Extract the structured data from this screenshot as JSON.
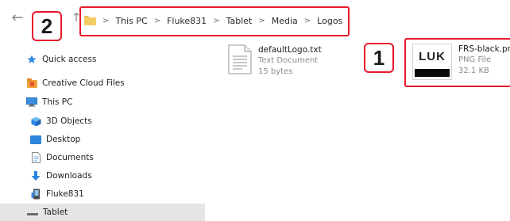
{
  "nav": {
    "back_icon": "←",
    "up_icon": "↑"
  },
  "breadcrumb": [
    "This PC",
    "Fluke831",
    "Tablet",
    "Media",
    "Logos"
  ],
  "breadcrumb_sep": ">",
  "callouts": {
    "one": "1",
    "two": "2"
  },
  "sidebar": {
    "items": [
      {
        "label": "Quick access",
        "icon": "star-icon"
      },
      {
        "label": "Creative Cloud Files",
        "icon": "creative-cloud-icon"
      },
      {
        "label": "This PC",
        "icon": "computer-icon"
      },
      {
        "label": "3D Objects",
        "icon": "3d-objects-icon"
      },
      {
        "label": "Desktop",
        "icon": "desktop-icon"
      },
      {
        "label": "Documents",
        "icon": "documents-icon"
      },
      {
        "label": "Downloads",
        "icon": "downloads-icon"
      },
      {
        "label": "Fluke831",
        "icon": "device-icon"
      },
      {
        "label": "Tablet",
        "icon": "folder-icon"
      }
    ]
  },
  "files": [
    {
      "name": "defaultLogo.txt",
      "type": "Text Document",
      "size": "15 bytes",
      "icon": "text-file-icon"
    },
    {
      "name": "FRS-black.png",
      "type": "PNG File",
      "size": "32.1 KB",
      "icon": "image-thumbnail-icon",
      "thumb_text": "LUK"
    }
  ],
  "colors": {
    "annotation": "#e8192c",
    "selection": "#e5e5e5"
  }
}
